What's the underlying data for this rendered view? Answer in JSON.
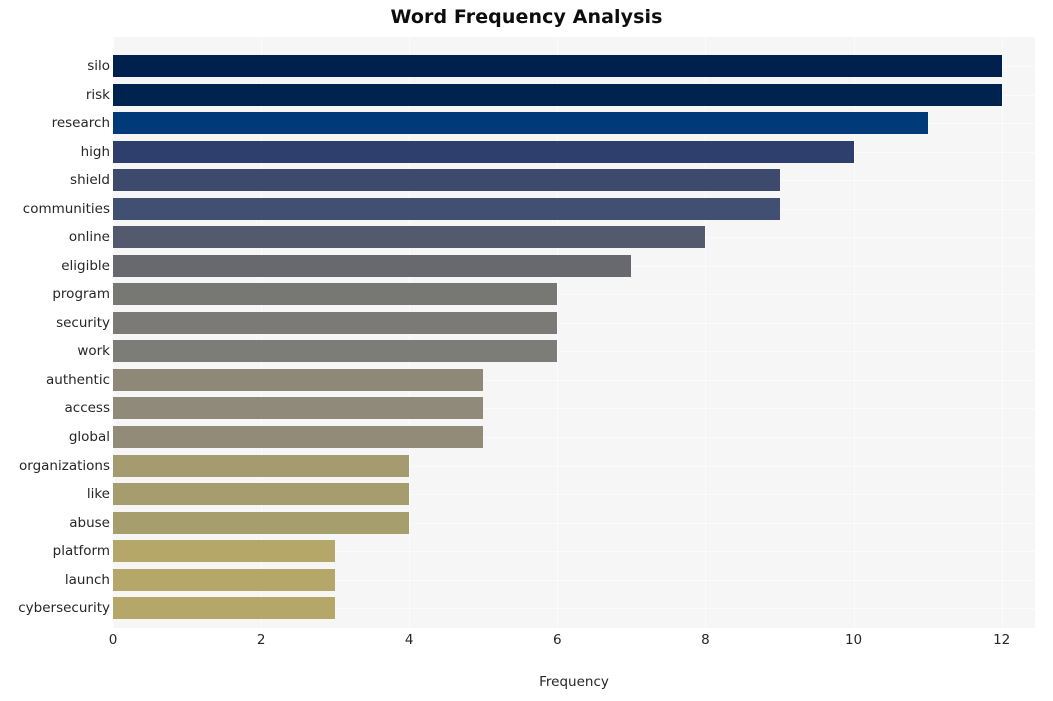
{
  "chart_data": {
    "type": "bar",
    "orientation": "horizontal",
    "title": "Word Frequency Analysis",
    "xlabel": "Frequency",
    "ylabel": "",
    "xlim": [
      0,
      12.45
    ],
    "xticks": [
      0,
      2,
      4,
      6,
      8,
      10,
      12
    ],
    "xtick_labels": [
      "0",
      "2",
      "4",
      "6",
      "8",
      "10",
      "12"
    ],
    "grid": true,
    "grid_axis": "both",
    "legend": null,
    "categories": [
      "silo",
      "risk",
      "research",
      "high",
      "shield",
      "communities",
      "online",
      "eligible",
      "program",
      "security",
      "work",
      "authentic",
      "access",
      "global",
      "organizations",
      "like",
      "abuse",
      "platform",
      "launch",
      "cybersecurity"
    ],
    "values": [
      12,
      12,
      11,
      10,
      9,
      9,
      8,
      7,
      6,
      6,
      6,
      5,
      5,
      5,
      4,
      4,
      4,
      3,
      3,
      3
    ],
    "bar_colors": [
      "#00204e",
      "#00224f",
      "#003a78",
      "#2e3f6e",
      "#3e4a6d",
      "#414f73",
      "#545a6d",
      "#67696f",
      "#777774",
      "#7b7a76",
      "#7c7c78",
      "#8d8878",
      "#8f8a79",
      "#918b78",
      "#a49c6e",
      "#a59d6e",
      "#a69e6d",
      "#b4a767",
      "#b5a768",
      "#b5a768"
    ],
    "plot_background": "#f6f6f7",
    "figure_background": "#ffffff",
    "title_color": "#0d0d0d",
    "text_color": "#262626"
  }
}
